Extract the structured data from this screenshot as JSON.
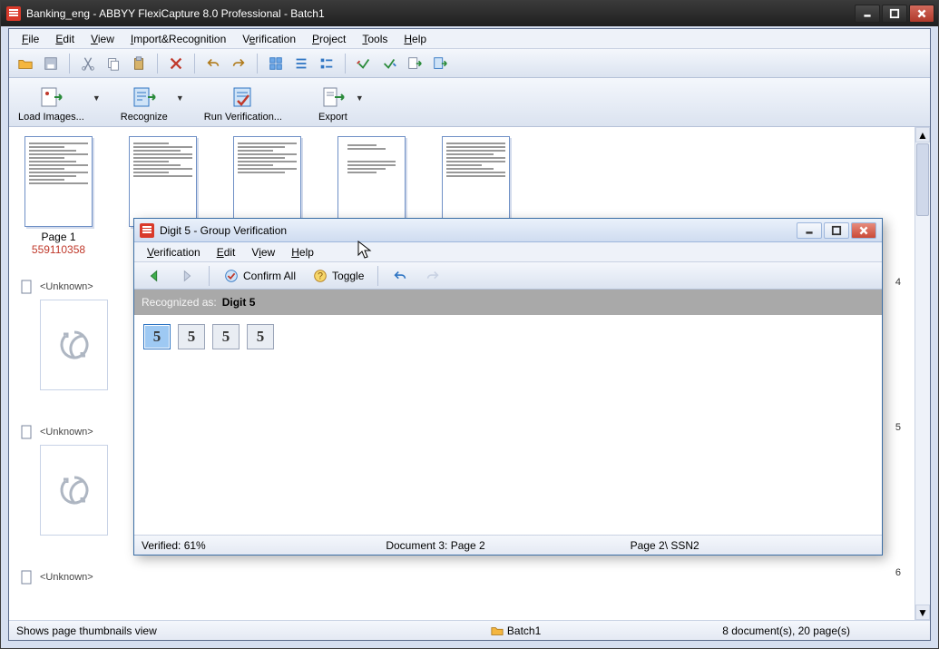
{
  "window": {
    "title": "Banking_eng - ABBYY FlexiCapture 8.0 Professional - Batch1"
  },
  "menu": {
    "file": "File",
    "edit": "Edit",
    "view": "View",
    "import": "Import&Recognition",
    "verification": "Verification",
    "project": "Project",
    "tools": "Tools",
    "help": "Help"
  },
  "bigbuttons": {
    "load": "Load Images...",
    "recognize": "Recognize",
    "runverif": "Run Verification...",
    "export": "Export"
  },
  "thumbs": {
    "page1_label": "Page 1",
    "page1_id": "559110358",
    "unknown": "<Unknown>"
  },
  "side_numbers": {
    "n4": "4",
    "n5": "5",
    "n6": "6"
  },
  "status": {
    "hint": "Shows page thumbnails view",
    "batch": "Batch1",
    "count": "8 document(s), 20 page(s)"
  },
  "dialog": {
    "title": "Digit 5 - Group Verification",
    "menu": {
      "verification": "Verification",
      "edit": "Edit",
      "view": "View",
      "help": "Help"
    },
    "toolbar": {
      "confirm": "Confirm All",
      "toggle": "Toggle"
    },
    "recognized_label": "Recognized as:",
    "recognized_value": "Digit 5",
    "chips": [
      "5",
      "5",
      "5",
      "5"
    ],
    "status": {
      "verified": "Verified: 61%",
      "doc": "Document 3: Page 2",
      "field": "Page 2\\ SSN2"
    }
  }
}
